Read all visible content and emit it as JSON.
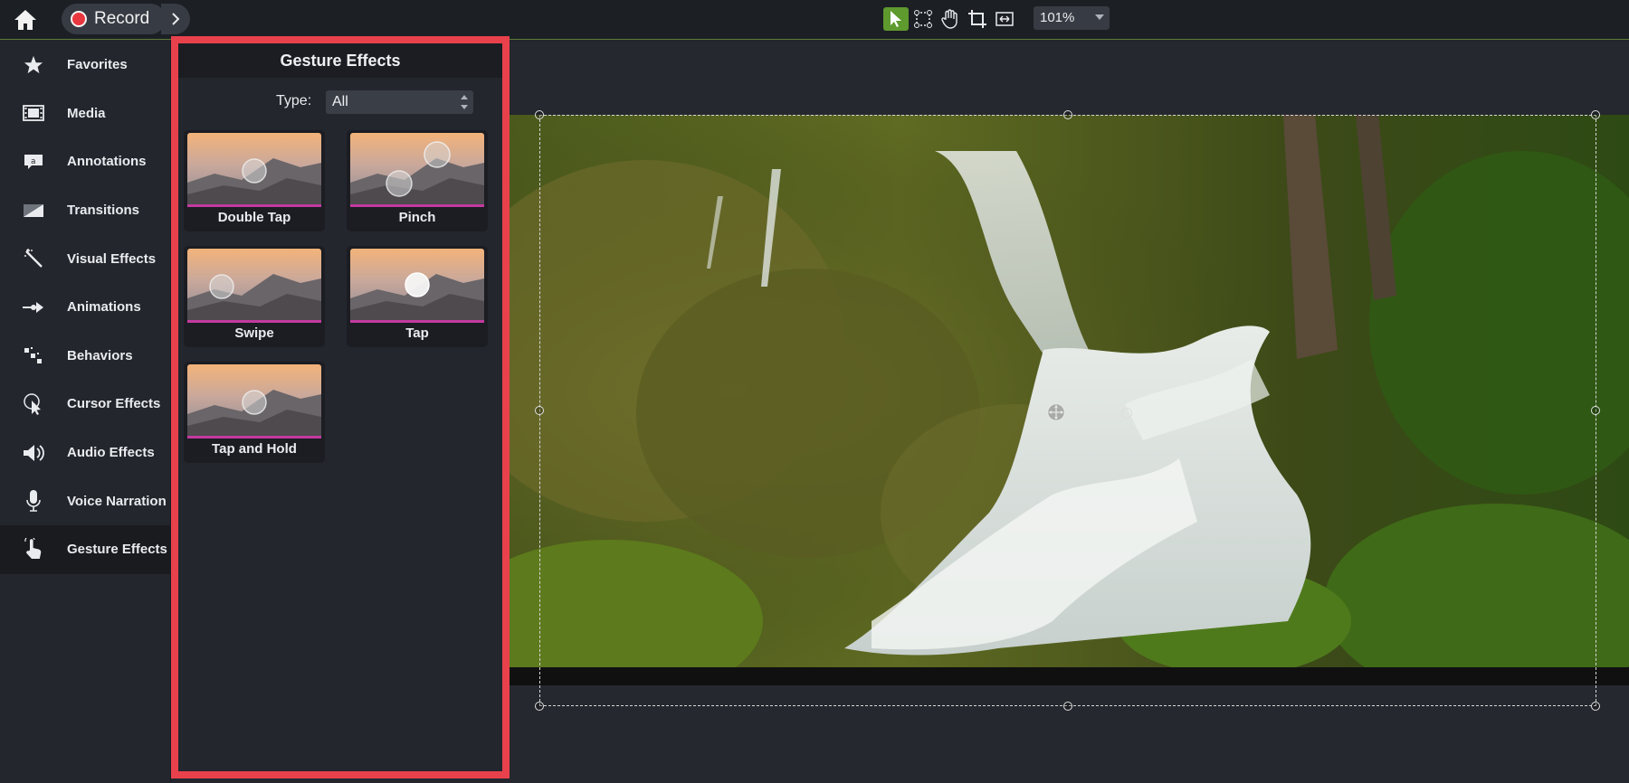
{
  "topbar": {
    "record_label": "Record",
    "zoom": "101%",
    "tools": [
      "select-arrow-icon",
      "edit-points-icon",
      "pan-hand-icon",
      "crop-icon",
      "fit-icon"
    ]
  },
  "sidebar": {
    "items": [
      {
        "label": "Favorites",
        "icon": "star-icon"
      },
      {
        "label": "Media",
        "icon": "film-icon"
      },
      {
        "label": "Annotations",
        "icon": "annotation-icon"
      },
      {
        "label": "Transitions",
        "icon": "transition-icon"
      },
      {
        "label": "Visual Effects",
        "icon": "magic-wand-icon"
      },
      {
        "label": "Animations",
        "icon": "animation-arrow-icon"
      },
      {
        "label": "Behaviors",
        "icon": "behaviors-icon"
      },
      {
        "label": "Cursor Effects",
        "icon": "cursor-icon"
      },
      {
        "label": "Audio Effects",
        "icon": "speaker-icon"
      },
      {
        "label": "Voice Narration",
        "icon": "microphone-icon"
      },
      {
        "label": "Gesture Effects",
        "icon": "hand-pointer-icon"
      }
    ],
    "active_index": 10
  },
  "panel": {
    "title": "Gesture Effects",
    "type_label": "Type:",
    "type_value": "All",
    "effects": [
      {
        "label": "Double Tap"
      },
      {
        "label": "Pinch"
      },
      {
        "label": "Swipe"
      },
      {
        "label": "Tap"
      },
      {
        "label": "Tap and Hold"
      }
    ]
  },
  "colors": {
    "accent_green": "#5e9a2e",
    "highlight_red": "#e8414c",
    "record_red": "#e8373f",
    "tile_underline": "#c23aa0"
  }
}
